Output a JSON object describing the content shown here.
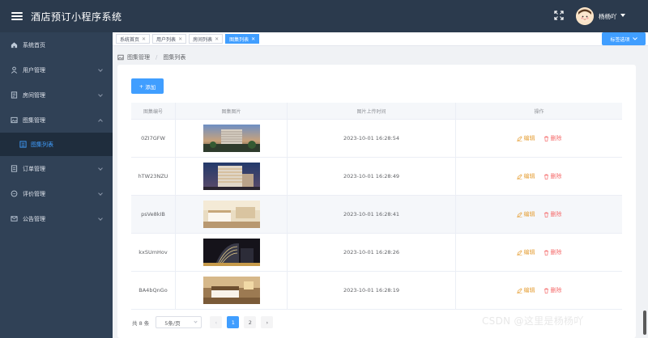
{
  "app": {
    "title": "酒店预订小程序系统"
  },
  "user": {
    "name": "杨杨吖"
  },
  "sidebar": {
    "items": [
      {
        "label": "系统首页",
        "icon": "home-icon",
        "chevron": false
      },
      {
        "label": "用户管理",
        "icon": "user-icon",
        "chevron": true
      },
      {
        "label": "房间管理",
        "icon": "room-icon",
        "chevron": true
      },
      {
        "label": "图集管理",
        "icon": "picture-icon",
        "chevron": true,
        "expanded": true
      },
      {
        "label": "订单管理",
        "icon": "order-icon",
        "chevron": true
      },
      {
        "label": "评价管理",
        "icon": "comment-icon",
        "chevron": true
      },
      {
        "label": "公告管理",
        "icon": "notice-icon",
        "chevron": true
      }
    ],
    "submenu": {
      "label": "图集列表",
      "icon": "list-icon"
    }
  },
  "tags": {
    "items": [
      {
        "label": "系统首页",
        "active": false
      },
      {
        "label": "用户列表",
        "active": false
      },
      {
        "label": "房间列表",
        "active": false
      },
      {
        "label": "图集列表",
        "active": true
      }
    ],
    "options_label": "标签选项"
  },
  "breadcrumb": {
    "parent": "图集管理",
    "separator": "/",
    "current": "图集列表"
  },
  "toolbar": {
    "add_label": "添加"
  },
  "table": {
    "headers": [
      "图集编号",
      "图集图片",
      "图片上传时间",
      "操作"
    ],
    "rows": [
      {
        "id": "0ZI7GFW",
        "time": "2023-10-01 16:28:54",
        "image": "hotel-exterior-dusk"
      },
      {
        "id": "hTW23NZU",
        "time": "2023-10-01 16:28:49",
        "image": "hotel-building-night"
      },
      {
        "id": "psVe8kIB",
        "time": "2023-10-01 16:28:41",
        "image": "hotel-room-bright"
      },
      {
        "id": "kxSUmHov",
        "time": "2023-10-01 16:28:26",
        "image": "hotel-tower-lights"
      },
      {
        "id": "BA4bQnGo",
        "time": "2023-10-01 16:28:19",
        "image": "hotel-bedroom-warm"
      }
    ],
    "edit_label": "编辑",
    "delete_label": "删除"
  },
  "pagination": {
    "total_text": "共 8 条",
    "page_size_text": "5条/页",
    "pages": [
      "1",
      "2"
    ],
    "current_page": "1",
    "prev": "‹",
    "next": "›"
  },
  "watermark": "CSDN @这里是杨杨吖",
  "colors": {
    "primary": "#409eff",
    "header": "#2b3a4d",
    "sidebar": "#304156",
    "edit": "#e6a23c",
    "delete": "#f56c6c"
  }
}
